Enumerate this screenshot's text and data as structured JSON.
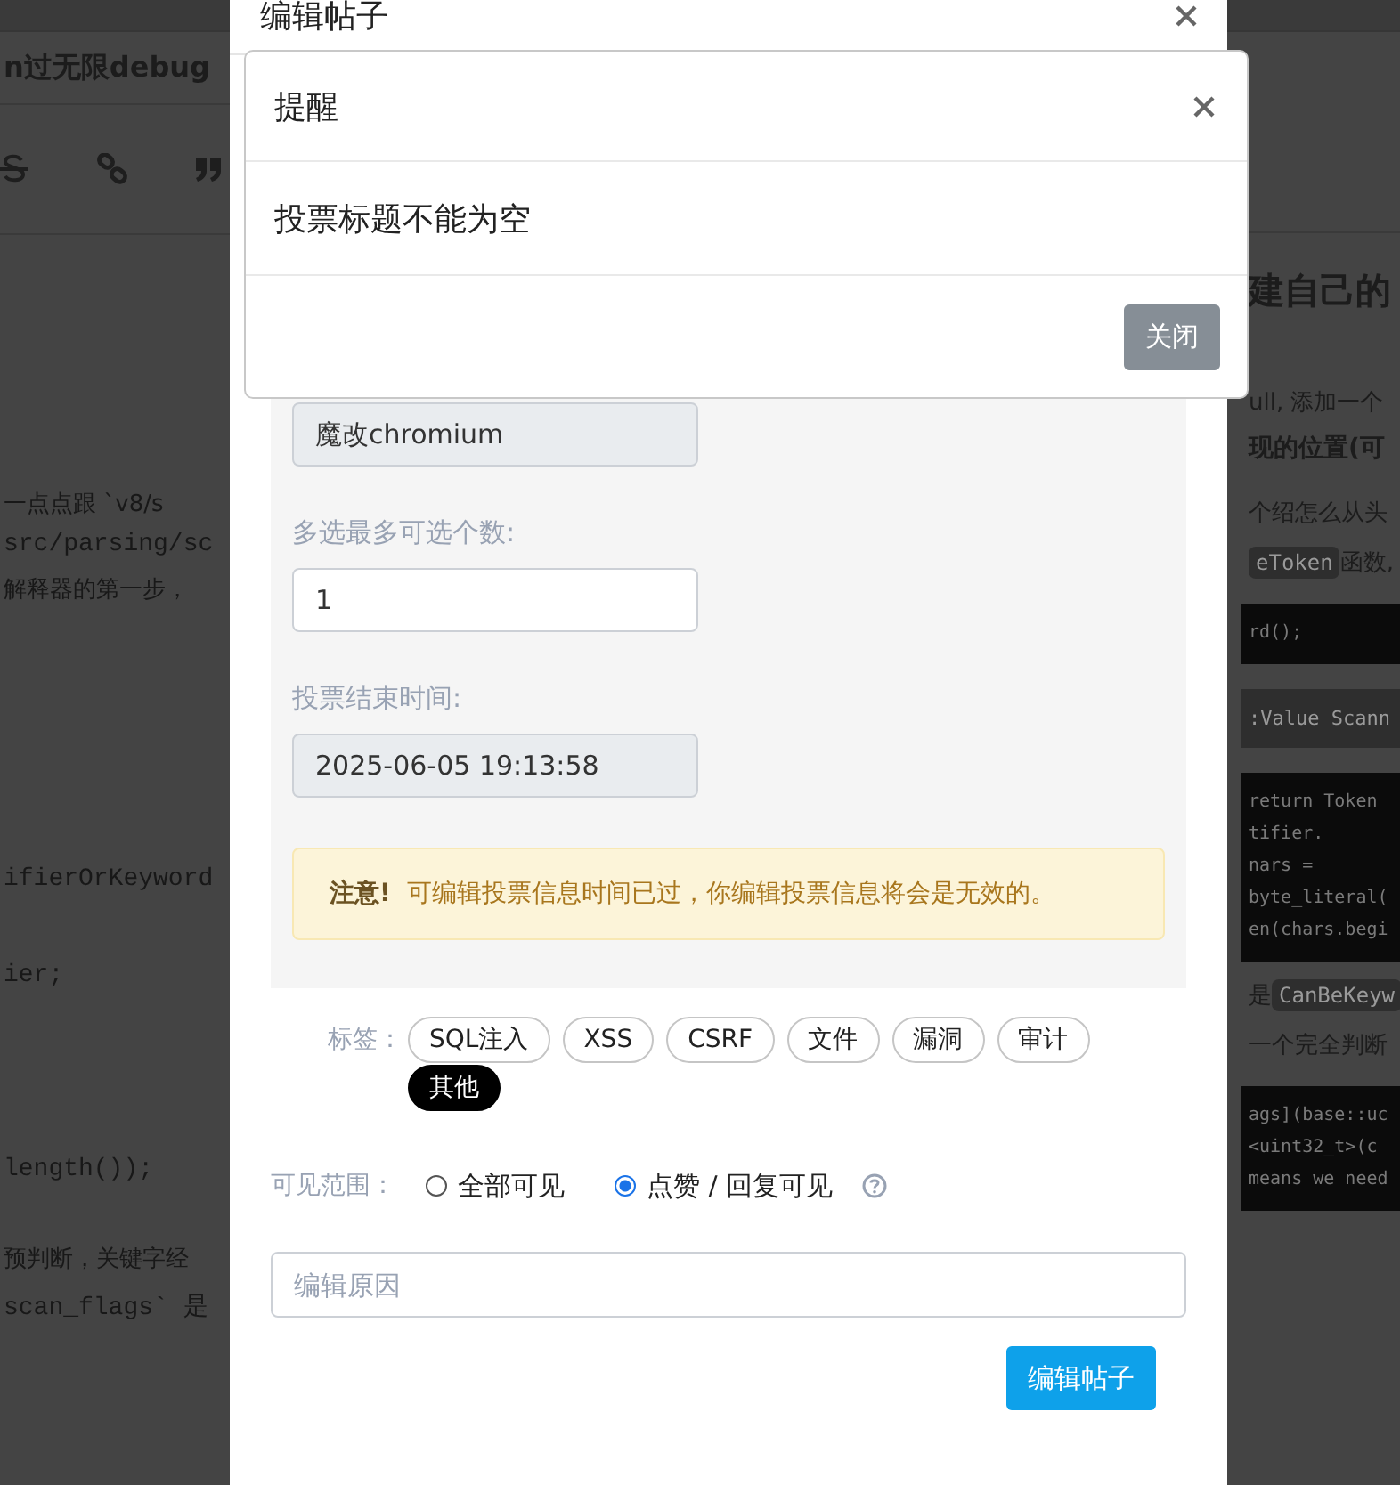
{
  "background_page": {
    "title": "n过无限debug",
    "left_lines": [
      {
        "kind": "text",
        "text": "一点点跟 `v8/s"
      },
      {
        "kind": "mono",
        "text": "src/parsing/sc"
      },
      {
        "kind": "text",
        "text": "解释器的第一步，"
      },
      {
        "kind": "mono",
        "text": "ifierOrKeyword"
      },
      {
        "kind": "mono",
        "text": "ier;"
      },
      {
        "kind": "mono",
        "text": "length());"
      },
      {
        "kind": "text",
        "text": "预判断，关键字经"
      },
      {
        "kind": "mono",
        "text": "scan_flags` 是"
      }
    ],
    "right_blocks": [
      {
        "kind": "heading",
        "text": "建自己的"
      },
      {
        "kind": "text",
        "segments": [
          {
            "kind": "plain",
            "text": "ull, 添加一个"
          }
        ]
      },
      {
        "kind": "subheading",
        "text": "现的位置(可"
      },
      {
        "kind": "text",
        "segments": [
          {
            "kind": "plain",
            "text": "个绍怎么从头"
          }
        ]
      },
      {
        "kind": "text",
        "segments": [
          {
            "kind": "code",
            "text": "eToken"
          },
          {
            "kind": "plain",
            "text": " 函数,"
          }
        ]
      },
      {
        "kind": "codeblock",
        "lines": [
          "rd();"
        ]
      },
      {
        "kind": "inlineblock",
        "text": ":Value Scann"
      },
      {
        "kind": "codeblock",
        "lines": [
          "return Token",
          "tifier.",
          "nars =",
          "byte_literal(",
          "en(chars.begi"
        ]
      },
      {
        "kind": "text",
        "segments": [
          {
            "kind": "plain",
            "text": "是 "
          },
          {
            "kind": "code",
            "text": "CanBeKeyw"
          }
        ]
      },
      {
        "kind": "text",
        "segments": [
          {
            "kind": "plain",
            "text": "一个完全判断"
          }
        ]
      },
      {
        "kind": "codeblock",
        "lines": [
          "ags](base::uc",
          "<uint32_t>(c",
          "means we need"
        ]
      }
    ]
  },
  "edit_modal": {
    "title": "编辑帖子",
    "vote_title": {
      "value": "魔改chromium",
      "disabled": true
    },
    "max_choices": {
      "label": "多选最多可选个数:",
      "value": "1",
      "disabled": false
    },
    "end_time": {
      "label": "投票结束时间:",
      "value": "2025-06-05 19:13:58",
      "disabled": true
    },
    "notice": {
      "strong": "注意!",
      "text": "可编辑投票信息时间已过，你编辑投票信息将会是无效的。"
    },
    "tags": {
      "label": "标签：",
      "items": [
        {
          "label": "SQL注入",
          "selected": false
        },
        {
          "label": "XSS",
          "selected": false
        },
        {
          "label": "CSRF",
          "selected": false
        },
        {
          "label": "文件",
          "selected": false
        },
        {
          "label": "漏洞",
          "selected": false
        },
        {
          "label": "审计",
          "selected": false
        },
        {
          "label": "其他",
          "selected": true
        }
      ]
    },
    "visibility": {
      "label": "可见范围：",
      "options": [
        {
          "label": "全部可见",
          "selected": false
        },
        {
          "label": "点赞 / 回复可见",
          "selected": true
        }
      ]
    },
    "reason": {
      "placeholder": "编辑原因"
    },
    "submit": "编辑帖子"
  },
  "alert_modal": {
    "title": "提醒",
    "message": "投票标题不能为空",
    "close_button": "关闭"
  }
}
